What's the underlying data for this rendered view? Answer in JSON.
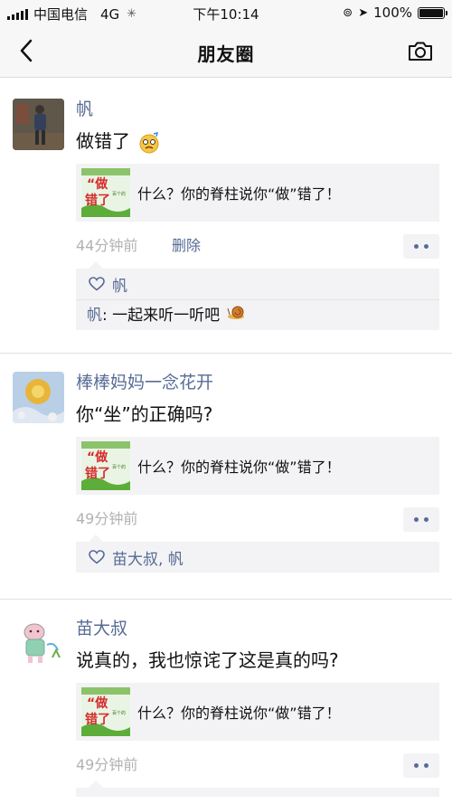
{
  "status_bar": {
    "carrier": "中国电信",
    "network": "4G",
    "time": "下午10:14",
    "battery": "100%",
    "battery_level": 1.0
  },
  "nav": {
    "title": "朋友圈",
    "back_icon": "chevron-left-icon",
    "camera_icon": "camera-icon"
  },
  "posts": [
    {
      "username": "帆",
      "text": "做错了",
      "link_title": "什么？你的脊柱说你“做”错了！",
      "time": "44分钟前",
      "delete_label": "删除",
      "likes": "帆",
      "comment_name": "帆",
      "comment_text": ": 一起来听一听吧"
    },
    {
      "username": "棒棒妈妈一念花开",
      "text": "你“坐”的正确吗?",
      "link_title": "什么？你的脊柱说你“做”错了！",
      "time": "49分钟前",
      "likes": "苗大叔, 帆"
    },
    {
      "username": "苗大叔",
      "text": "说真的，我也惊诧了这是真的吗?",
      "link_title": "什么？你的脊柱说你“做”错了！",
      "time": "49分钟前"
    }
  ],
  "thumb": {
    "top_char": "“做",
    "bottom_char": "错了",
    "badge": "百个的"
  }
}
